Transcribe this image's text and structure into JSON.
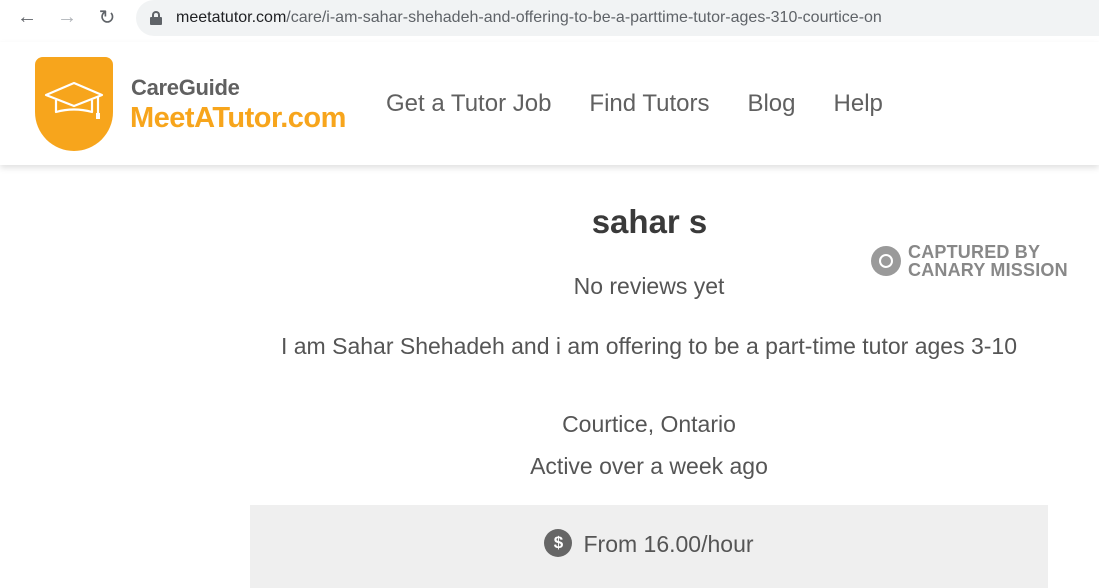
{
  "browser": {
    "url_host": "meetatutor.com",
    "url_path": "/care/i-am-sahar-shehadeh-and-offering-to-be-a-parttime-tutor-ages-310-courtice-on"
  },
  "header": {
    "brand_top": "CareGuide",
    "brand_main": "MeetATutor.com",
    "nav": [
      "Get a Tutor Job",
      "Find Tutors",
      "Blog",
      "Help"
    ]
  },
  "profile": {
    "name": "sahar s",
    "reviews": "No reviews yet",
    "tagline": "I am Sahar Shehadeh and i am offering to be a part-time tutor ages 3-10",
    "location": "Courtice, Ontario",
    "activity": "Active over a week ago",
    "rate": "From 16.00/hour",
    "rate_icon": "$"
  },
  "watermark": {
    "line1": "CAPTURED BY",
    "line2": "CANARY MISSION"
  },
  "colors": {
    "brand_orange": "#f7a51c",
    "brand_gray": "#606060"
  }
}
